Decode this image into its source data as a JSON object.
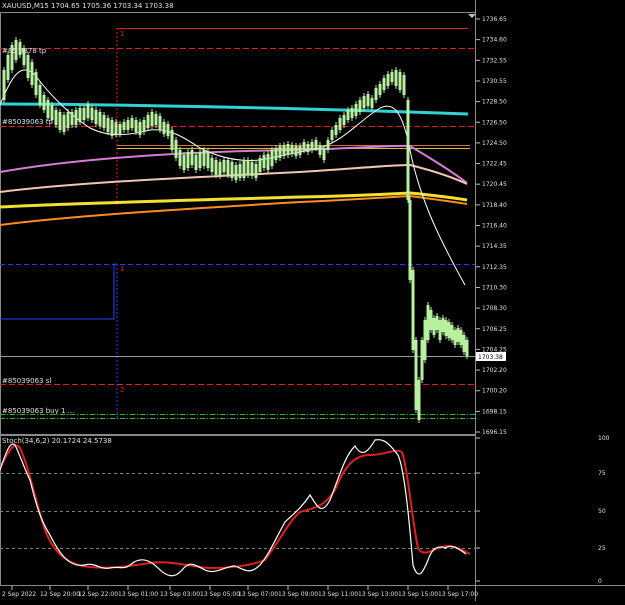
{
  "main_chart": {
    "header": "XAUUSD,M15  1704.65 1705.36 1703.34 1703.38",
    "order_labels": {
      "tp1": "#85 3378 tp",
      "tp2": "#85039063 tp",
      "sl": "#85039063 sl",
      "buy_stack": "#85039063 buy 1 ..."
    },
    "fibo_labels": {
      "level1": "1",
      "level1_sub": "1",
      "level2": "2"
    },
    "current_price": "1703.38",
    "price_axis": [
      "1736.65",
      "1734.60",
      "1732.55",
      "1730.55",
      "1728.50",
      "1726.50",
      "1724.50",
      "1722.45",
      "1720.45",
      "1718.40",
      "1716.40",
      "1714.35",
      "1712.35",
      "1710.30",
      "1708.30",
      "1706.25",
      "1704.25",
      "1702.20",
      "1700.20",
      "1698.15",
      "1696.15"
    ]
  },
  "stoch_panel": {
    "header": "Stoch(34,6,2) 20.1724 24.5738",
    "levels": [
      "100",
      "75",
      "50",
      "25",
      "0"
    ]
  },
  "time_axis": [
    "2 Sep 2022",
    "12 Sep 20:00",
    "12 Sep 22:00",
    "13 Sep 01:00",
    "13 Sep 03:00",
    "13 Sep 05:00",
    "13 Sep 07:00",
    "13 Sep 09:00",
    "13 Sep 11:00",
    "13 Sep 13:00",
    "13 Sep 15:00",
    "13 Sep 17:00"
  ],
  "colors": {
    "cyan_ma": "#2fd3d3",
    "white_ma": "#ffffff",
    "magenta_ma": "#d77bd7",
    "peach_ma": "#f2c5b0",
    "yellow_ma": "#f0e030",
    "orange_ma": "#ff8c20",
    "candle": "#b8f0a0",
    "stoch_main": "#ffffff",
    "stoch_signal": "#e02020"
  }
}
